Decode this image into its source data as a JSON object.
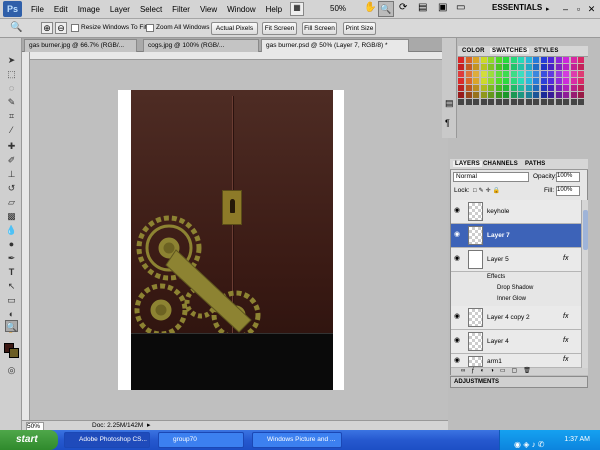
{
  "menubar": {
    "logo": "Ps",
    "items": [
      "File",
      "Edit",
      "Image",
      "Layer",
      "Select",
      "Filter",
      "View",
      "Window",
      "Help"
    ],
    "zoom": "50%",
    "workspace": "ESSENTIALS"
  },
  "options": {
    "resize_label": "Resize Windows To Fit",
    "zoom_all_label": "Zoom All Windows",
    "actual_pixels": "Actual Pixels",
    "fit_screen": "Fit Screen",
    "fill_screen": "Fill Screen",
    "print_size": "Print Size"
  },
  "tabs": [
    {
      "label": "gas burner.jpg @ 66.7% (RGB/..."
    },
    {
      "label": "cogs.jpg @ 100% (RGB/..."
    },
    {
      "label": "gas burner.psd @ 50% (Layer 7, RGB/8) *"
    }
  ],
  "status": {
    "zoom": "50%",
    "doc": "Doc: 2.25M/142M"
  },
  "panels": {
    "color_tab": "COLOR",
    "swatches_tab": "SWATCHES",
    "styles_tab": "STYLES",
    "layers_tab": "LAYERS",
    "channels_tab": "CHANNELS",
    "paths_tab": "PATHS",
    "blend_mode": "Normal",
    "opacity_label": "Opacity:",
    "opacity_value": "100%",
    "lock_label": "Lock:",
    "fill_label": "Fill:",
    "fill_value": "100%",
    "adjustments_tab": "ADJUSTMENTS"
  },
  "layers": [
    {
      "name": "keyhole"
    },
    {
      "name": "Layer 7"
    },
    {
      "name": "Layer 5",
      "fx": "fx"
    },
    {
      "name": "Layer 4 copy 2",
      "fx": "fx"
    },
    {
      "name": "Layer 4",
      "fx": "fx"
    },
    {
      "name": "arm1",
      "fx": "fx"
    }
  ],
  "effects": {
    "title": "Effects",
    "items": [
      "Drop Shadow",
      "Inner Glow"
    ]
  },
  "taskbar": {
    "start": "start",
    "tasks": [
      "Adobe Photoshop CS...",
      "group70",
      "Windows Picture and ..."
    ],
    "clock": "1:37 AM"
  },
  "colors": {
    "accent": "#3d63b8",
    "selected_layer": "#3d63b8",
    "taskbar": "#2659cf",
    "start": "#3a9636"
  }
}
